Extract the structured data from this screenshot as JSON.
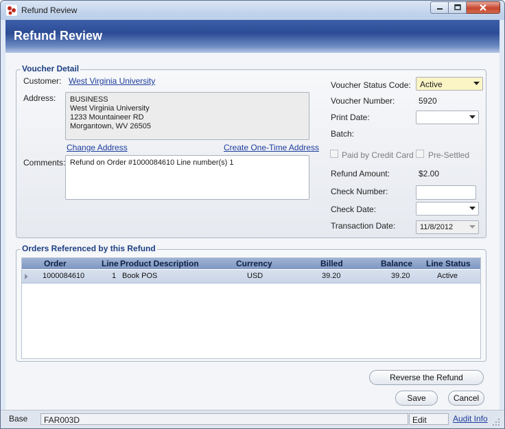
{
  "window": {
    "title": "Refund Review"
  },
  "header": {
    "title": "Refund Review"
  },
  "voucher_detail": {
    "group_title": "Voucher Detail",
    "customer_label": "Customer:",
    "customer_value": "West Virginia University",
    "address_label": "Address:",
    "address_lines": [
      "BUSINESS",
      "West Virginia University",
      "1233 Mountaineer RD",
      "Morgantown, WV 26505"
    ],
    "change_address": "Change Address",
    "create_one_time_address": "Create One-Time Address",
    "comments_label": "Comments:",
    "comments_value": "Refund on Order #1000084610 Line number(s) 1",
    "voucher_status_label": "Voucher Status Code:",
    "voucher_status_value": "Active",
    "voucher_number_label": "Voucher Number:",
    "voucher_number_value": "5920",
    "print_date_label": "Print Date:",
    "print_date_value": "",
    "batch_label": "Batch:",
    "batch_value": "",
    "paid_by_cc_label": "Paid by Credit Card",
    "pre_settled_label": "Pre-Settled",
    "refund_amount_label": "Refund Amount:",
    "refund_amount_value": "$2.00",
    "check_number_label": "Check Number:",
    "check_number_value": "",
    "check_date_label": "Check Date:",
    "check_date_value": "",
    "transaction_date_label": "Transaction Date:",
    "transaction_date_value": "11/8/2012"
  },
  "orders": {
    "group_title": "Orders Referenced by this Refund",
    "columns": [
      "Order",
      "Line",
      "Product Description",
      "Currency",
      "Billed",
      "Balance",
      "Line Status"
    ],
    "rows": [
      {
        "order": "1000084610",
        "line": "1",
        "product": "Book POS",
        "currency": "USD",
        "billed": "39.20",
        "balance": "39.20",
        "status": "Active"
      }
    ]
  },
  "buttons": {
    "reverse": "Reverse the Refund",
    "save": "Save",
    "cancel": "Cancel"
  },
  "statusbar": {
    "base": "Base",
    "code": "FAR003D",
    "mode": "Edit",
    "audit": "Audit Info"
  },
  "colors": {
    "header_blue": "#2d4c95",
    "status_combo_bg": "#fbf4c4",
    "link": "#1d3c9c"
  }
}
